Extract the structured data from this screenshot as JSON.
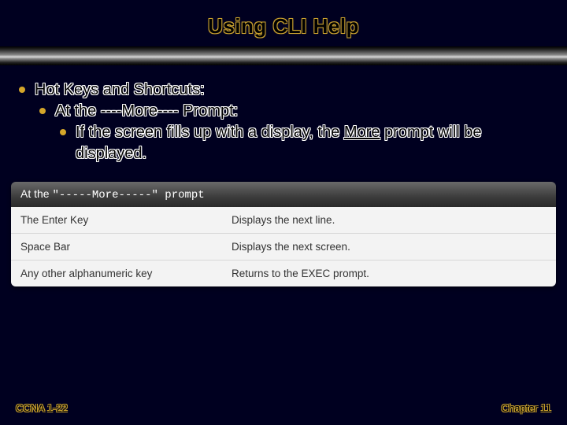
{
  "title": "Using CLI Help",
  "bullets": {
    "l1": "Hot Keys and Shortcuts:",
    "l2": "At the ----More---- Prompt:",
    "l3a": "If the screen fills up with a display, the ",
    "l3b": "More",
    "l3c": " prompt will be displayed."
  },
  "table": {
    "header_prefix": "At the ",
    "header_mono": "\"-----More-----\" prompt",
    "rows": [
      {
        "key": "The Enter Key",
        "val": "Displays the next line."
      },
      {
        "key": "Space Bar",
        "val": "Displays the next screen."
      },
      {
        "key": "Any other alphanumeric key",
        "val": "Returns to the EXEC prompt."
      }
    ]
  },
  "footer": {
    "left": "CCNA 1-22",
    "right": "Chapter 11"
  }
}
